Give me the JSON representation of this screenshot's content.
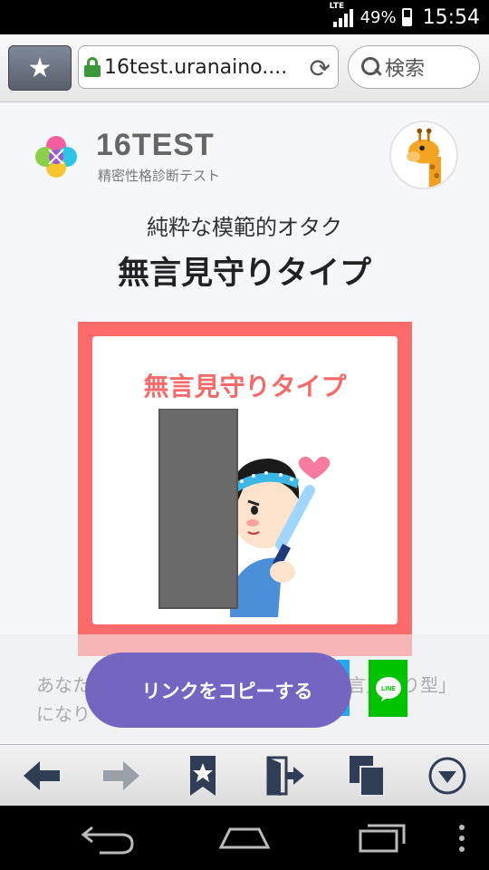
{
  "status_bar": {
    "network": "LTE",
    "battery": "49%",
    "time": "15:54"
  },
  "browser": {
    "url": "16test.uranaino....",
    "search_placeholder": "検索"
  },
  "site": {
    "name": "16TEST",
    "tagline": "精密性格診断テスト"
  },
  "result": {
    "subtype": "純粋な模範的オタク",
    "type_name": "無言見守りタイプ",
    "card_title": "無言見守りタイプ"
  },
  "share": {
    "text_line1": "あなた",
    "text_line2": "になり",
    "text_right": "言見守り型」",
    "copy_button": "リンクをコピーする",
    "line_label": "LINE"
  },
  "colors": {
    "card_border": "#ff6b6b",
    "card_title": "#f46a6a",
    "copy_button": "#7466c0",
    "line_green": "#00c300"
  },
  "bottom_toolbar": {
    "icons": [
      "back-icon",
      "forward-icon",
      "bookmark-icon",
      "exit-icon",
      "tabs-icon",
      "menu-icon"
    ]
  },
  "nav_bar": {
    "icons": [
      "back-nav-icon",
      "home-nav-icon",
      "recent-apps-icon",
      "overflow-icon"
    ]
  }
}
